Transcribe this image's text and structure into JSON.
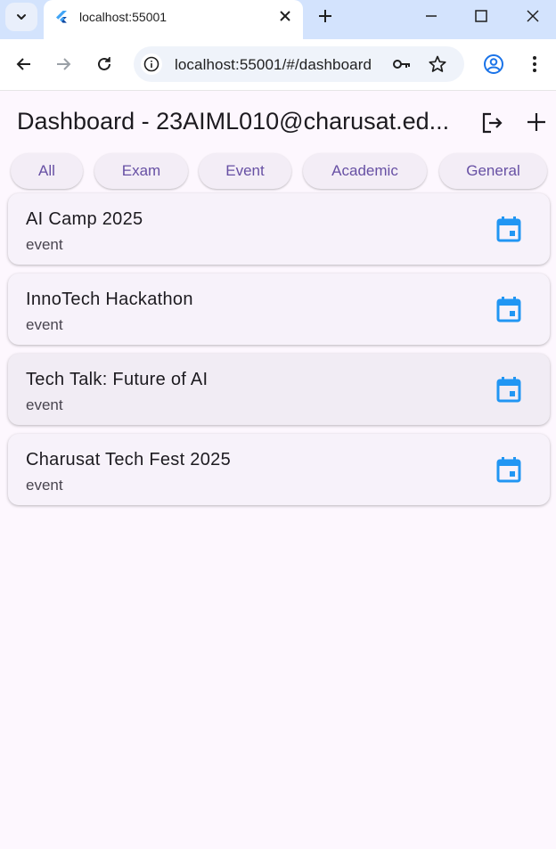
{
  "browser": {
    "tab_title": "localhost:55001",
    "url": "localhost:55001/#/dashboard",
    "colors": {
      "tabstrip": "#d3e3fd",
      "omnibox": "#eff3fa",
      "profile": "#1a73e8"
    }
  },
  "app": {
    "title": "Dashboard - 23AIML010@charusat.ed...",
    "actions": {
      "logout_icon": "logout-icon",
      "add_icon": "add-icon"
    },
    "accent": "#6750a4",
    "icon_color": "#2196f3"
  },
  "filters": [
    "All",
    "Exam",
    "Event",
    "Academic",
    "General"
  ],
  "events": [
    {
      "title": "AI Camp 2025",
      "type": "event",
      "icon": "calendar-icon"
    },
    {
      "title": "InnoTech Hackathon",
      "type": "event",
      "icon": "calendar-icon"
    },
    {
      "title": "Tech Talk: Future of AI",
      "type": "event",
      "icon": "calendar-icon"
    },
    {
      "title": "Charusat Tech Fest 2025",
      "type": "event",
      "icon": "calendar-icon"
    }
  ]
}
